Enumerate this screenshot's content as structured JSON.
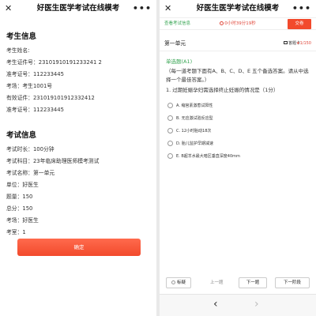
{
  "left": {
    "title": "好医生医学考试在线模考",
    "close_glyph": "✕",
    "more_glyph": "•••",
    "candidate_section": "考生信息",
    "candidate_lines": [
      "考生姓名:",
      "考生证件号：23101910191233241 2",
      "准考证号：112233445",
      "考场：考生1001号",
      "有效证件：231019101912332412",
      "准考证号：112233445"
    ],
    "exam_section": "考试信息",
    "exam_lines": [
      "考试时长：100分钟",
      "考试科目：23年临床助理医师模考测试",
      "考试名称：第一单元",
      "单位：好医生",
      "题量：150",
      "总分：150",
      "考场：好医生",
      "考室：1"
    ],
    "confirm_label": "确定"
  },
  "right": {
    "title": "好医生医学考试在线模考",
    "close_glyph": "✕",
    "more_glyph": "•••",
    "view_info": "查看考试信息",
    "timer": "0小时39分19秒",
    "submit_label": "交卷",
    "unit_name": "第一单元",
    "answer_card": "答题卡",
    "fav": "★1/150",
    "question_type": "单选题(A1)",
    "question_desc": "（每一道考题下面有A、B、C、D、E 五个备选答案。请从中选择一个最佳答案。）",
    "question_stem": "1. 过期妊娠孕妇需选择终止妊娠的情况是（1分）",
    "options": [
      "A. 缩宫素激惹试阳性",
      "B. 无应激试验反应型",
      "C. 12小时胎动18次",
      "D. 胎儿监护早期减速",
      "E. B超羊水最大暗区垂直深度40mm"
    ],
    "mark_label": "标疑",
    "prev_label": "上一题",
    "next_label": "下一题",
    "next_stage_label": "下一阶段",
    "back_glyph": "‹",
    "forward_glyph": "›"
  }
}
